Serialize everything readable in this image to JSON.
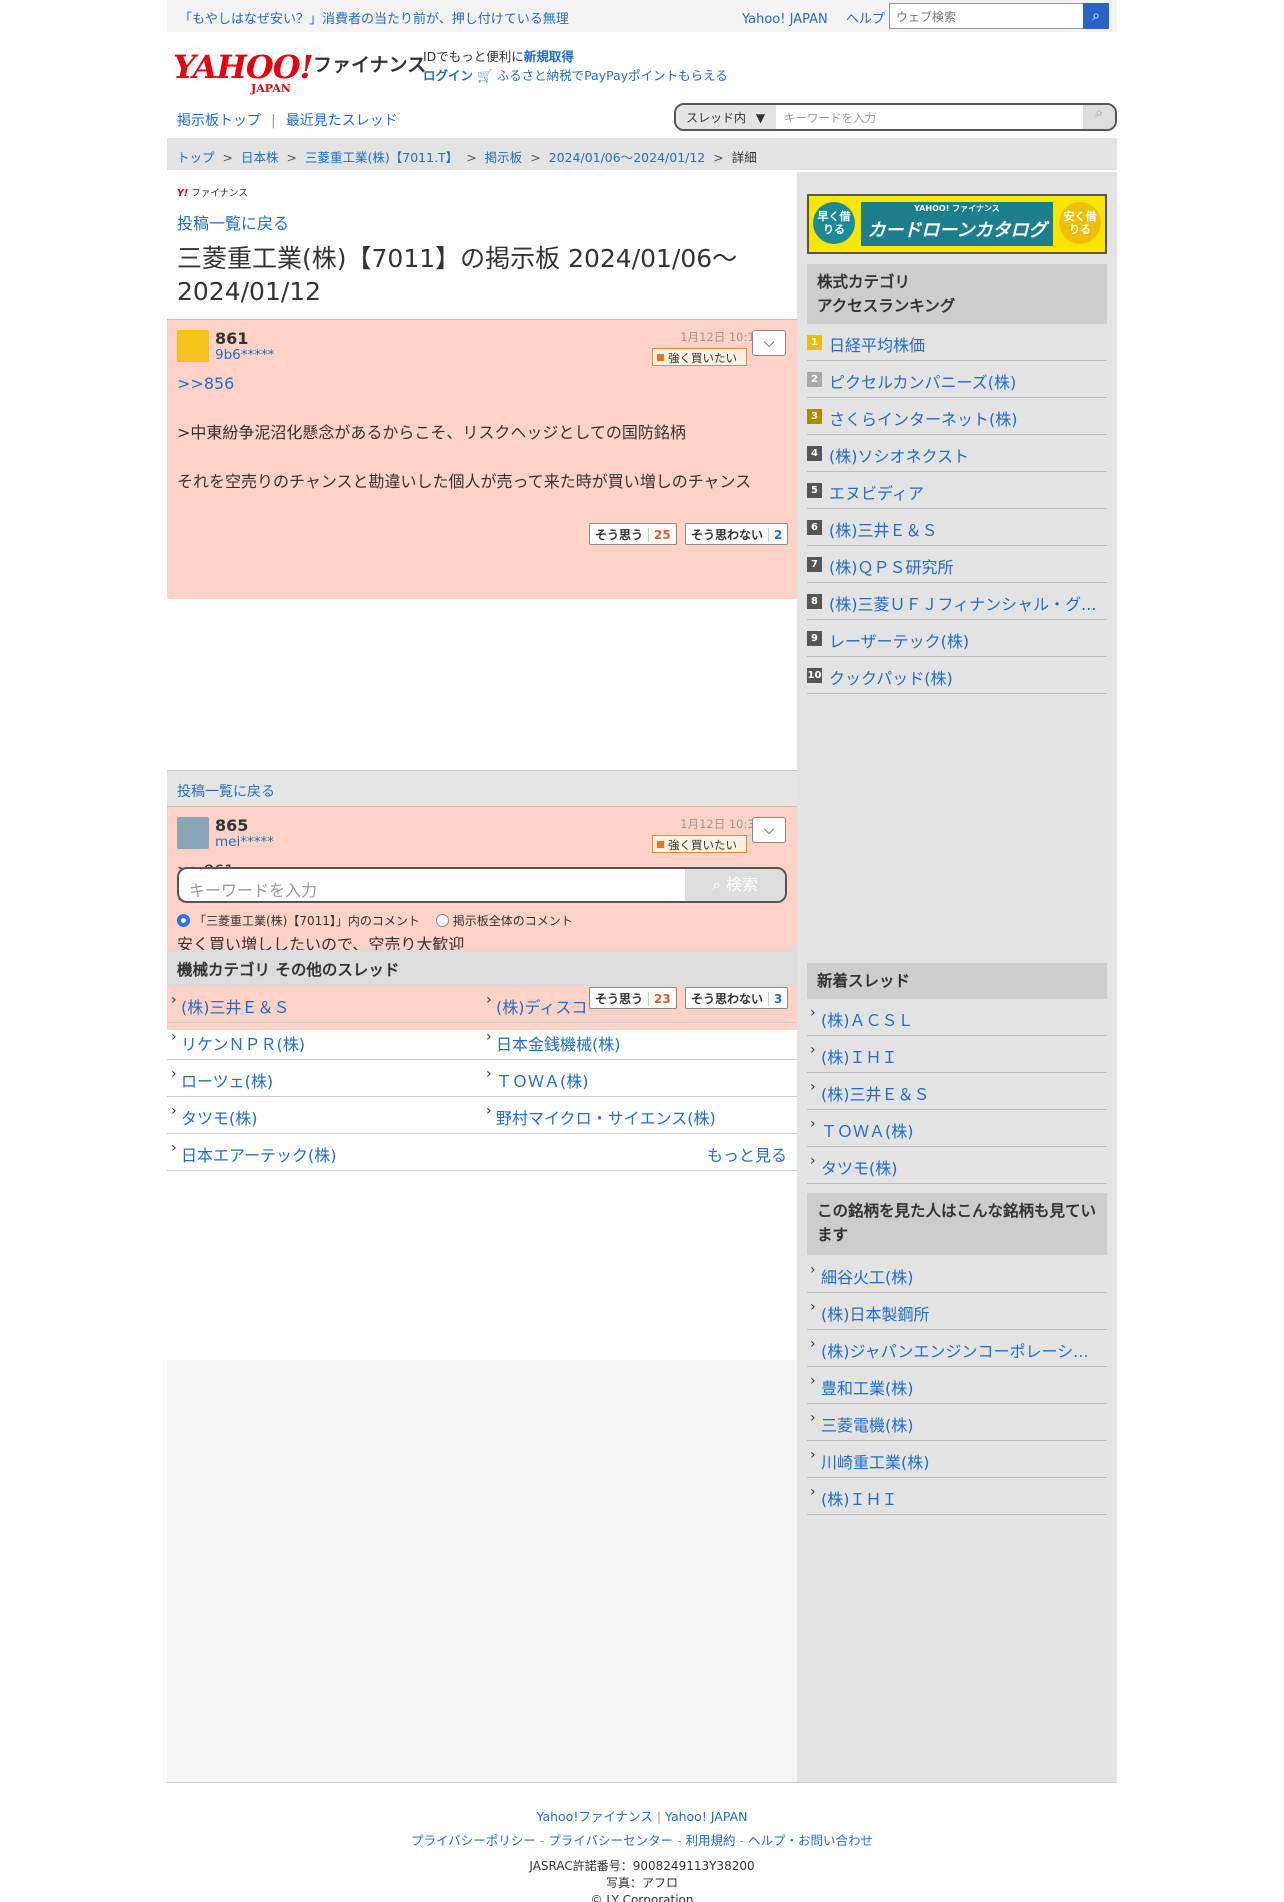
{
  "topbar": {
    "news": "「もやしはなぜ安い？」消費者の当たり前が、押し付けている無理",
    "links": [
      "Yahoo! JAPAN",
      "ヘルプ"
    ],
    "search_placeholder": "ウェブ検索"
  },
  "header": {
    "logo_main": "YAHOO!",
    "logo_sub": "JAPAN",
    "logo_finance": "ファイナンス",
    "id_text": "IDでもっと便利に",
    "id_link": "新規取得",
    "login": "ログイン",
    "promo": "ふるさと納税でPayPayポイントもらえる"
  },
  "board_nav": {
    "top": "掲示板トップ",
    "sep": "|",
    "recent": "最近見たスレッド"
  },
  "thread_search": {
    "scope": "スレッド内",
    "placeholder": "キーワードを入力"
  },
  "breadcrumb": [
    "トップ",
    "日本株",
    "三菱重工業(株)【7011.T】",
    "掲示板",
    "2024/01/06〜2024/01/12",
    "詳細"
  ],
  "mini_logo": "ファイナンス",
  "back_link": "投稿一覧に戻る",
  "page_title": "三菱重工業(株)【7011】の掲示板 2024/01/06〜2024/01/12",
  "posts": [
    {
      "num": "861",
      "user": "9b6*****",
      "date": "1月12日 10:18",
      "sentiment": "強く買いたい",
      "reply_to": ">>856",
      "body": ">中東紛争泥沼化懸念があるからこそ、リスクヘッジとしての国防銘柄\n\nそれを空売りのチャンスと勘違いした個人が売って来た時が買い増しのチャンス",
      "agree_label": "そう思う",
      "agree": "25",
      "disagree_label": "そう思わない",
      "disagree": "2"
    },
    {
      "num": "865",
      "user": "mei*****",
      "date": "1月12日 10:31",
      "sentiment": "強く買いたい",
      "body": ">>861\n>それを空売りのチャンスと勘違いした個人が売って来た時が買い増しのチャンス\n\n安く買い増ししたいので、空売り大歓迎",
      "agree_label": "そう思う",
      "agree": "23",
      "disagree_label": "そう思わない",
      "disagree": "3"
    }
  ],
  "bottom_search": {
    "placeholder": "キーワードを入力",
    "button": "検索",
    "radio1": "「三菱重工業(株)【7011】」内のコメント",
    "radio2": "掲示板全体のコメント"
  },
  "other_threads": {
    "title": "機械カテゴリ  その他のスレッド",
    "items": [
      "(株)三井Ｅ＆Ｓ",
      "(株)ディスコ",
      "リケンＮＰＲ(株)",
      "日本金銭機械(株)",
      "ローツェ(株)",
      "ＴＯＷＡ(株)",
      "タツモ(株)",
      "野村マイクロ・サイエンス(株)",
      "日本エアーテック(株)"
    ],
    "more": "もっと見る"
  },
  "ad": {
    "left": "早く借りる",
    "brand": "YAHOO! ファイナンス",
    "center": "カードローンカタログ",
    "right": "安く借りる"
  },
  "ranking": {
    "title": "株式カテゴリ\nアクセスランキング",
    "items": [
      "日経平均株価",
      "ピクセルカンパニーズ(株)",
      "さくらインターネット(株)",
      "(株)ソシオネクスト",
      "エヌビディア",
      "(株)三井Ｅ＆Ｓ",
      "(株)ＱＰＳ研究所",
      "(株)三菱ＵＦＪフィナンシャル・グ...",
      "レーザーテック(株)",
      "クックパッド(株)"
    ]
  },
  "new_threads": {
    "title": "新着スレッド",
    "items": [
      "(株)ＡＣＳＬ",
      "(株)ＩＨＩ",
      "(株)三井Ｅ＆Ｓ",
      "ＴＯＷＡ(株)",
      "タツモ(株)"
    ]
  },
  "also_viewed": {
    "title": "この銘柄を見た人はこんな銘柄も見ています",
    "items": [
      "細谷火工(株)",
      "(株)日本製鋼所",
      "(株)ジャパンエンジンコーポレーシ...",
      "豊和工業(株)",
      "三菱電機(株)",
      "川崎重工業(株)",
      "(株)ＩＨＩ"
    ]
  },
  "footer": {
    "link1": "Yahoo!ファイナンス",
    "link2": "Yahoo! JAPAN",
    "links": [
      "プライバシーポリシー",
      "プライバシーセンター",
      "利用規約",
      "ヘルプ・お問い合わせ"
    ],
    "jasrac": "JASRAC許諾番号：9008249113Y38200",
    "photo": "写真：アフロ",
    "copyright": "© LY Corporation"
  }
}
